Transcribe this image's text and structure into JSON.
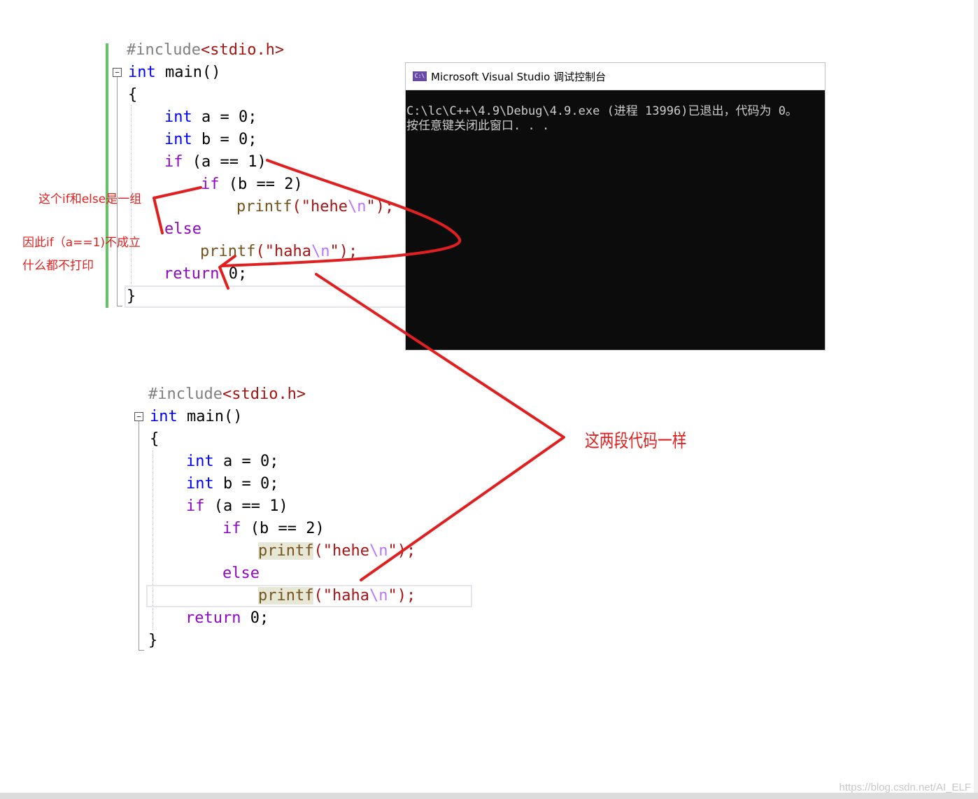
{
  "code_top": {
    "line1": [
      "#include",
      "<stdio.h>"
    ],
    "line2": [
      "int",
      " main()"
    ],
    "line3": "{",
    "line4": [
      "int",
      " a = 0;"
    ],
    "line5": [
      "int",
      " b = 0;"
    ],
    "line6": [
      "if",
      " (a == 1)"
    ],
    "line7": [
      "if",
      " (b == 2)"
    ],
    "line8": [
      "printf",
      "(\"",
      "hehe",
      "\\n",
      "\");"
    ],
    "line9": "else",
    "line10": [
      "printf",
      "(\"",
      "haha",
      "\\n",
      "\");"
    ],
    "line11": [
      "return",
      " 0;"
    ],
    "line12": "}"
  },
  "code_bottom": {
    "line1": [
      "#include",
      "<stdio.h>"
    ],
    "line2": [
      "int",
      " main()"
    ],
    "line3": "{",
    "line4": [
      "int",
      " a = 0;"
    ],
    "line5": [
      "int",
      " b = 0;"
    ],
    "line6": [
      "if",
      " (a == 1)"
    ],
    "line7": [
      "if",
      " (b == 2)"
    ],
    "line8": [
      "printf",
      "(\"",
      "hehe",
      "\\n",
      "\");"
    ],
    "line9": "else",
    "line10": [
      "printf",
      "(\"",
      "haha",
      "\\n",
      "\");"
    ],
    "line11": [
      "return",
      " 0;"
    ],
    "line12": "}"
  },
  "fold_symbol": "−",
  "console": {
    "title": "Microsoft Visual Studio 调试控制台",
    "icon_text": "C:\\",
    "line1": "C:\\lc\\C++\\4.9\\Debug\\4.9.exe (进程 13996)已退出，代码为 0。",
    "line2": "按任意键关闭此窗口. . ."
  },
  "annotations": {
    "note1": "这个if和else是一组",
    "note2": "因此if（a==1)不成立",
    "note3": "什么都不打印",
    "note4": "这两段代码一样"
  },
  "watermark": "https://blog.csdn.net/AI_ELF",
  "colors": {
    "keyword": "#0000ff",
    "annotation": "#e02020",
    "console_bg": "#0c0c0c"
  }
}
